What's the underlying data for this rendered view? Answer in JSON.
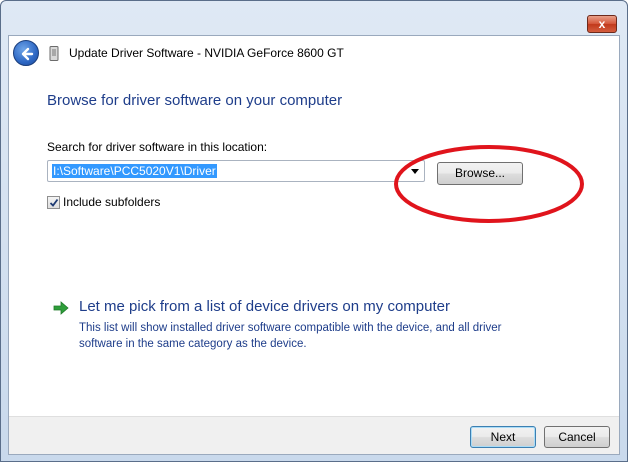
{
  "window": {
    "close_glyph": "x"
  },
  "header": {
    "title": "Update Driver Software - NVIDIA GeForce 8600 GT",
    "back_icon": "back-arrow-icon",
    "device_icon": "device-icon"
  },
  "main": {
    "heading": "Browse for driver software on your computer",
    "search_label": "Search for driver software in this location:",
    "path_value": "I:\\Software\\PCC5020V1\\Driver",
    "browse_label": "Browse...",
    "include_subfolders_label": "Include subfolders",
    "include_subfolders_checked": true
  },
  "pick_option": {
    "title": "Let me pick from a list of device drivers on my computer",
    "description": "This list will show installed driver software compatible with the device, and all driver software in the same category as the device."
  },
  "footer": {
    "next_label": "Next",
    "cancel_label": "Cancel"
  },
  "colors": {
    "heading_blue": "#1e3d8a",
    "selection_blue": "#3399ff",
    "annotation_red": "#e0141c",
    "link_arrow_green": "#2e9e3a"
  }
}
